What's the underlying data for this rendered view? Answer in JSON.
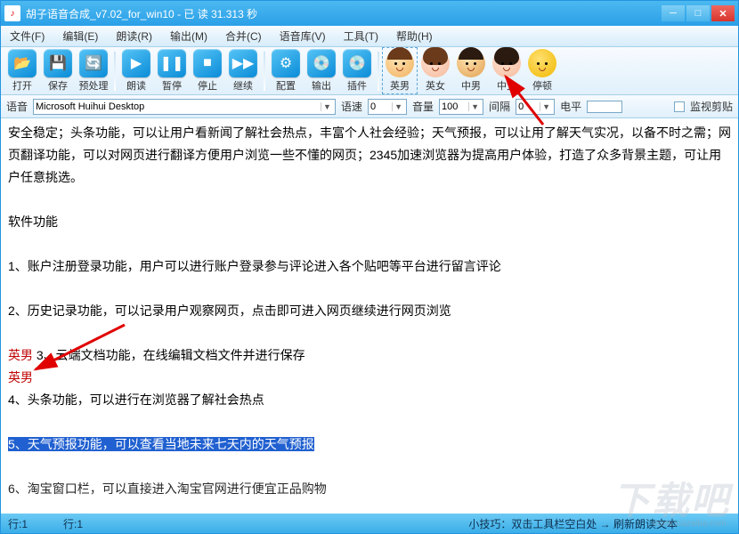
{
  "title": "胡子语音合成_v7.02_for_win10  -  已 读 31.313 秒",
  "menu": [
    "文件(F)",
    "编辑(E)",
    "朗读(R)",
    "输出(M)",
    "合并(C)",
    "语音库(V)",
    "工具(T)",
    "帮助(H)"
  ],
  "tools": {
    "open": "打开",
    "save": "保存",
    "preproc": "预处理",
    "read": "朗读",
    "pause": "暂停",
    "stop": "停止",
    "continue": "继续",
    "config": "配置",
    "output": "输出",
    "plugin": "插件",
    "yin_nan": "英男",
    "yin_nv": "英女",
    "zhong_nan": "中男",
    "zhong_nv": "中女",
    "pause_icon": "停顿"
  },
  "params": {
    "voice_label": "语音",
    "voice_value": "Microsoft Huihui Desktop",
    "speed_label": "语速",
    "speed_value": "0",
    "volume_label": "音量",
    "volume_value": "100",
    "interval_label": "间隔",
    "interval_value": "0",
    "level_label": "电平",
    "monitor_label": "监视剪贴"
  },
  "body": {
    "p1": "安全稳定；头条功能，可以让用户看新闻了解社会热点，丰富个人社会经验；天气预报，可以让用了解天气实况，以备不时之需；网页翻译功能，可以对网页进行翻译方便用户浏览一些不懂的网页；2345加速浏览器为提高用户体验，打造了众多背景主题，可让用户任意挑选。",
    "p2": "软件功能",
    "p3": "1、账户注册登录功能，用户可以进行账户登录参与评论进入各个贴吧等平台进行留言评论",
    "p4": "2、历史记录功能，可以记录用户观察网页，点击即可进入网页继续进行网页浏览",
    "p5_pre": "英男 ",
    "p5": "3、云端文档功能，在线编辑文档文件并进行保存",
    "p5b": "英男",
    "p6": "4、头条功能，可以进行在浏览器了解社会热点",
    "p7": "5、天气预报功能，可以查看当地未来七天内的天气预报",
    "p8": "6、淘宝窗口栏，可以直接进入淘宝官网进行便宜正品购物"
  },
  "status": {
    "line": "行:1",
    "col": "行:1",
    "tip": "小技巧：双击工具栏空白处 → 刷新朗读文本"
  },
  "watermark": "下载吧",
  "watermark_sub": "www.xiazaiba.com"
}
